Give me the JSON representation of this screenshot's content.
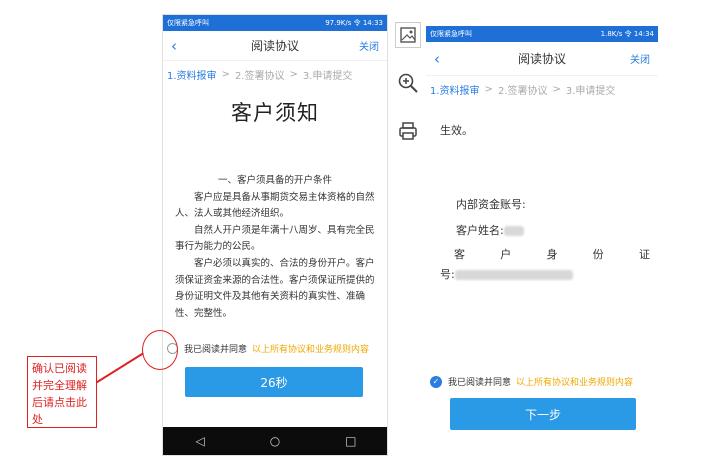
{
  "left_phone": {
    "status": {
      "left": "仅限紧急呼叫",
      "right": "97.9K/s 令 14:33"
    },
    "nav": {
      "back": "‹",
      "title": "阅读协议",
      "close": "关闭"
    },
    "steps": [
      {
        "label": "1.资料报审",
        "active": true
      },
      {
        "label": "2.签署协议",
        "active": false
      },
      {
        "label": "3.申请提交",
        "active": false
      }
    ],
    "step_separator": ">",
    "doc_title": "客户须知",
    "doc_heading": "一、客户须具备的开户条件",
    "paragraphs": [
      "客户应是具备从事期货交易主体资格的自然人、法人或其他经济组织。",
      "自然人开户须是年满十八周岁、具有完全民事行为能力的公民。",
      "客户必须以真实的、合法的身份开户。客户须保证资金来源的合法性。客户须保证所提供的身份证明文件及其他有关资料的真实性、准确性、完整性。"
    ],
    "agree_text": "我已阅读并同意",
    "agree_link": "以上所有协议和业务规则内容",
    "timer_button": "26秒",
    "softkeys": [
      "◁",
      "○",
      "□"
    ]
  },
  "toolbar": {
    "image_icon": "image-icon",
    "zoom_icon": "zoom-in-icon",
    "print_icon": "print-icon"
  },
  "right_phone": {
    "status": {
      "left": "仅限紧急呼叫",
      "right": "1.8K/s 令 14:34"
    },
    "nav": {
      "back": "‹",
      "title": "阅读协议",
      "close": "关闭"
    },
    "steps": [
      {
        "label": "1.资料报审",
        "active": true
      },
      {
        "label": "2.签署协议",
        "active": false
      },
      {
        "label": "3.申请提交",
        "active": false
      }
    ],
    "effective_text": "生效。",
    "fund_account_label": "内部资金账号:",
    "customer_name_label": "客户姓名:",
    "id_label_chars": [
      "客",
      "户",
      "身",
      "份",
      "证"
    ],
    "id_label_tail": "号:",
    "agree_text": "我已阅读并同意",
    "agree_link": "以上所有协议和业务规则内容",
    "next_button": "下一步"
  },
  "annotation": {
    "text": "确认已阅读并完全理解后请点击此处",
    "color": "#dd2222"
  },
  "colors": {
    "accent": "#2a7de1",
    "button": "#2a99e6",
    "link": "#f0a800",
    "statusbar": "#1e70d6"
  }
}
